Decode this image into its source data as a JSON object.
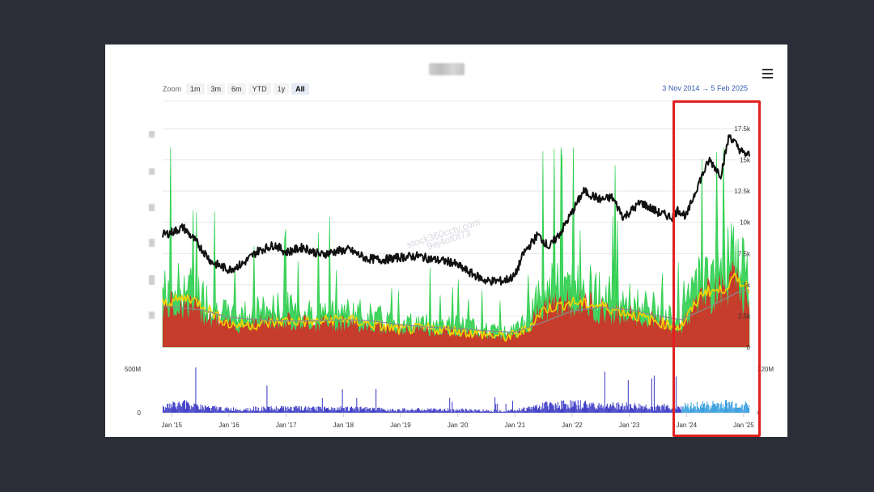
{
  "toolbar": {
    "zoom_label": "Zoom",
    "zoom_buttons": [
      "1m",
      "3m",
      "6m",
      "YTD",
      "1y",
      "All"
    ],
    "active_zoom": "All",
    "range_start": "3 Nov 2014",
    "range_arrow": "→",
    "range_end": "5 Feb 2025"
  },
  "watermark": {
    "line1": "stock360cctv.com",
    "line2": "9ej4ot0f73"
  },
  "colors": {
    "price_line": "#111111",
    "volume_ratio_fill": "#22cc44",
    "volume_ratio_red": "#dd2222",
    "ma_yellow": "#f5d400",
    "ma_gray": "#8a8a8a",
    "volume_bars": "#4040c8",
    "volume_bars_recent": "#3aa0e0",
    "highlight_box": "#e02020",
    "axis_text": "#333333"
  },
  "chart_data": [
    {
      "type": "line",
      "title": "",
      "x_tick_labels": [
        "Jan '15",
        "Jan '16",
        "Jan '17",
        "Jan '18",
        "Jan '19",
        "Jan '20",
        "Jan '21",
        "Jan '22",
        "Jan '23",
        "Jan '24",
        "Jan '25"
      ],
      "y_tick_labels": [
        "0",
        "2.5k",
        "5k",
        "7.5k",
        "10k",
        "12.5k",
        "15k",
        "17.5k"
      ],
      "ylim": [
        0,
        17500
      ],
      "x_range": [
        "2014-11-03",
        "2025-02-05"
      ],
      "grid": true,
      "series": [
        {
          "key": "price",
          "x": [
            2014.84,
            2015.0,
            2015.2,
            2015.45,
            2015.7,
            2016.0,
            2016.25,
            2016.5,
            2016.8,
            2017.0,
            2017.3,
            2017.6,
            2017.9,
            2018.1,
            2018.4,
            2018.7,
            2019.0,
            2019.3,
            2019.6,
            2019.9,
            2020.2,
            2020.5,
            2020.8,
            2021.0,
            2021.15,
            2021.4,
            2021.6,
            2021.8,
            2022.0,
            2022.2,
            2022.5,
            2022.7,
            2022.9,
            2023.2,
            2023.5,
            2023.75,
            2023.85,
            2024.0,
            2024.2,
            2024.4,
            2024.6,
            2024.75,
            2024.9,
            2025.0,
            2025.1
          ],
          "y": [
            9000,
            9200,
            9600,
            8300,
            6800,
            6200,
            6700,
            7700,
            8200,
            7600,
            8000,
            7400,
            7700,
            7800,
            7100,
            7000,
            7200,
            7300,
            7000,
            6800,
            6000,
            5300,
            5300,
            5700,
            7500,
            9000,
            8000,
            9200,
            10800,
            12500,
            11800,
            12000,
            10400,
            11600,
            10800,
            10400,
            11000,
            10500,
            13000,
            15000,
            13800,
            17000,
            16000,
            15500,
            15400
          ]
        },
        {
          "key": "ma_yellow",
          "x": [
            2014.84,
            2015.3,
            2015.6,
            2016.0,
            2016.5,
            2017.0,
            2017.5,
            2018.0,
            2018.5,
            2019.0,
            2019.5,
            2020.0,
            2020.5,
            2020.9,
            2021.2,
            2021.5,
            2022.0,
            2022.5,
            2023.0,
            2023.5,
            2023.9,
            2024.3,
            2024.6,
            2024.85,
            2025.1
          ],
          "y": [
            3500,
            4000,
            3200,
            1800,
            1800,
            2100,
            2000,
            2300,
            1800,
            1400,
            1500,
            1300,
            1000,
            800,
            1400,
            3000,
            3600,
            3300,
            2700,
            2000,
            1600,
            4500,
            4500,
            5500,
            4800
          ]
        },
        {
          "key": "ma_gray",
          "x": [
            2014.84,
            2015.5,
            2016.0,
            2016.5,
            2017.0,
            2017.5,
            2018.0,
            2018.5,
            2019.0,
            2019.5,
            2020.0,
            2020.5,
            2021.0,
            2021.5,
            2022.0,
            2022.5,
            2023.0,
            2023.5,
            2023.9,
            2024.3,
            2024.6,
            2024.9,
            2025.1
          ],
          "y": [
            3300,
            3000,
            2400,
            2200,
            2100,
            2100,
            2200,
            2100,
            1800,
            1600,
            1500,
            1300,
            1200,
            2000,
            2900,
            3200,
            3000,
            2500,
            2200,
            3000,
            3700,
            4400,
            4600
          ]
        }
      ],
      "bands": [
        {
          "key": "volume_ratio_envelope",
          "x": [
            2014.84,
            2015.2,
            2015.5,
            2016.0,
            2016.5,
            2017.0,
            2017.5,
            2018.0,
            2018.5,
            2019.0,
            2019.5,
            2020.0,
            2020.5,
            2020.9,
            2021.2,
            2021.5,
            2021.8,
            2022.2,
            2022.6,
            2023.0,
            2023.5,
            2023.9,
            2024.2,
            2024.5,
            2024.8,
            2025.0,
            2025.1
          ],
          "y": [
            5500,
            6000,
            5000,
            3000,
            3500,
            3800,
            3300,
            3500,
            3000,
            2400,
            2300,
            2200,
            1700,
            1400,
            2500,
            5500,
            6000,
            6000,
            5000,
            4300,
            3600,
            2600,
            6500,
            7500,
            9000,
            7500,
            5800
          ]
        }
      ]
    },
    {
      "type": "bar",
      "title": "",
      "y_tick_labels": [
        "0",
        "500M"
      ],
      "y_right_tick_labels": [
        "0",
        "320M"
      ],
      "ylim": [
        0,
        600
      ],
      "unit": "M",
      "x": [
        2014.84,
        2015.2,
        2015.5,
        2016.0,
        2016.5,
        2017.0,
        2017.5,
        2018.0,
        2018.5,
        2019.0,
        2019.5,
        2020.0,
        2020.5,
        2020.9,
        2021.2,
        2021.5,
        2021.8,
        2022.2,
        2022.6,
        2023.0,
        2023.5,
        2023.9,
        2024.2,
        2024.5,
        2024.8,
        2025.1
      ],
      "y": [
        120,
        180,
        110,
        70,
        80,
        90,
        80,
        90,
        70,
        60,
        60,
        55,
        45,
        40,
        80,
        150,
        170,
        160,
        140,
        130,
        110,
        120,
        150,
        160,
        170,
        150
      ]
    }
  ]
}
